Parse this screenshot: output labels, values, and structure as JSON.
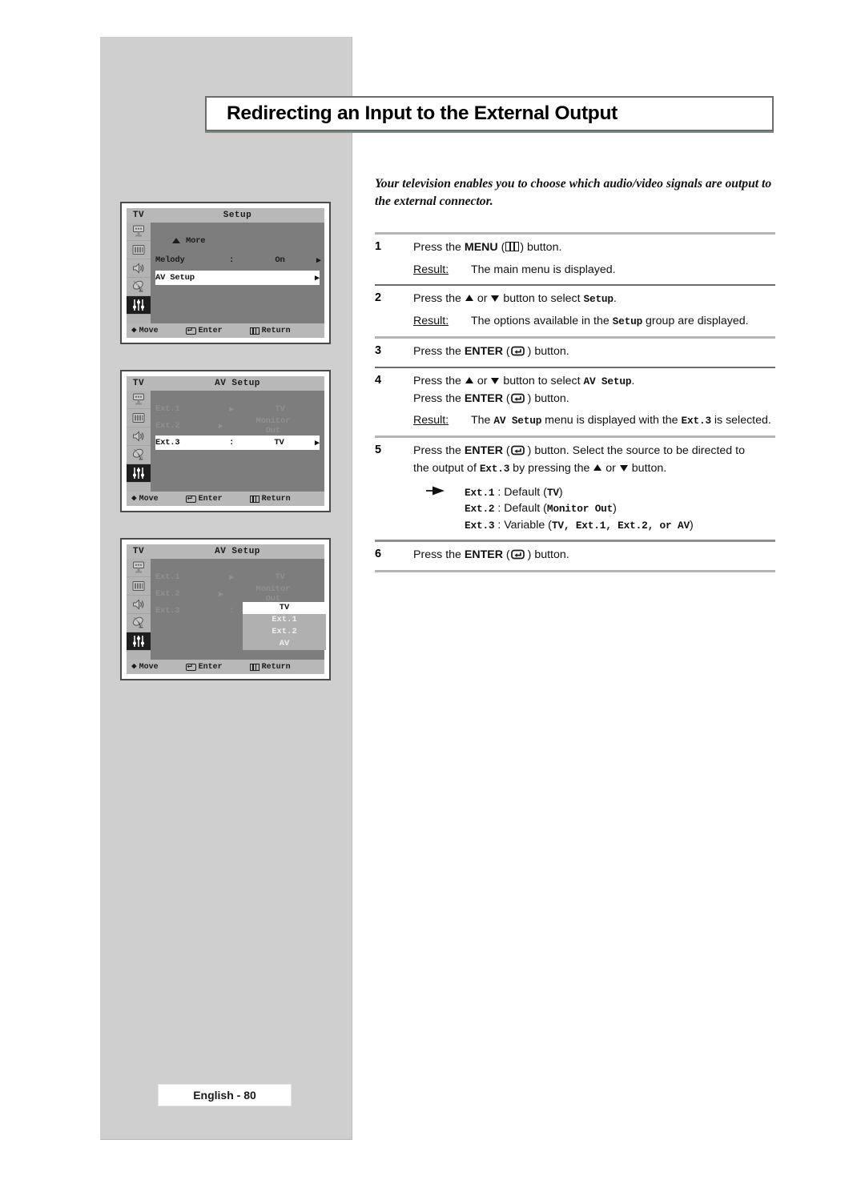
{
  "page": {
    "title": "Redirecting an Input to the External Output",
    "intro": "Your television enables you to choose which audio/video signals are output to the external connector.",
    "footer_label": "English - 80"
  },
  "steps": [
    {
      "num": "1",
      "lines": [
        "Press the MENU (▤) button."
      ],
      "press_prefix": "Press the ",
      "press_bold": "MENU",
      "press_suffix": " button.",
      "result_label": "Result:",
      "result_text": "The main menu is displayed."
    },
    {
      "num": "2",
      "press_prefix": "Press the ",
      "press_mid": " or ",
      "press_tail": " button to select ",
      "press_mono": "Setup",
      "press_end": ".",
      "result_label": "Result:",
      "result_pre": "The options available in the ",
      "result_mono": "Setup",
      "result_post": " group are displayed."
    },
    {
      "num": "3",
      "press_prefix": "Press the ",
      "press_bold": "ENTER",
      "press_suffix": " button."
    },
    {
      "num": "4",
      "press_prefix": "Press the ",
      "press_tail": " button to select ",
      "press_mono": "AV Setup",
      "press_end": ".",
      "press2_prefix": "Press the ",
      "press2_bold": "ENTER",
      "press2_suffix": " button.",
      "result_label": "Result:",
      "result_pre": "The ",
      "result_mono": "AV Setup",
      "result_mid": " menu is displayed with the ",
      "result_mono2": "Ext.3",
      "result_post": " is selected."
    },
    {
      "num": "5",
      "press_prefix": "Press the ",
      "press_bold": "ENTER",
      "press_suffix": " button. Select the source to be directed to",
      "press2_pre": "the output of ",
      "press2_mono": "Ext.3",
      "press2_mid": " by pressing the ",
      "press2_end": " button.",
      "notes": [
        {
          "name": "Ext.1",
          "sep": " : Default (",
          "value": "TV",
          "close": ")",
          "value_mono": true
        },
        {
          "name": "Ext.2",
          "sep": " : Default (",
          "value": "Monitor Out",
          "close": ")",
          "value_mono": true
        },
        {
          "name": "Ext.3",
          "sep": " : Variable (",
          "value": "TV, Ext.1, Ext.2, or AV",
          "close": ")",
          "value_mono": true
        }
      ]
    },
    {
      "num": "6",
      "press_prefix": "Press the ",
      "press_bold": "ENTER",
      "press_suffix": " button."
    }
  ],
  "osd": [
    {
      "id": "setup-menu",
      "tv_label": "TV",
      "title": "Setup",
      "rows": [
        {
          "kind": "more",
          "label": "More",
          "state": "dark"
        },
        {
          "kind": "item",
          "label": "Melody",
          "colon": ":",
          "value": "On",
          "arrow": "▶",
          "state": "dark"
        },
        {
          "kind": "item",
          "label": "AV Setup",
          "colon": "",
          "value": "",
          "arrow": "▶",
          "state": "selected"
        }
      ],
      "footer": {
        "move": "Move",
        "enter": "Enter",
        "return": "Return"
      }
    },
    {
      "id": "av-setup-menu",
      "tv_label": "TV",
      "title": "AV Setup",
      "rows": [
        {
          "kind": "item",
          "label": "Ext.1",
          "colon": "▶",
          "value": "TV",
          "arrow": "",
          "state": "dim"
        },
        {
          "kind": "item",
          "label": "Ext.2",
          "colon": "▶",
          "value": "Monitor Out",
          "arrow": "",
          "state": "dim"
        },
        {
          "kind": "item",
          "label": "Ext.3",
          "colon": ":",
          "value": "TV",
          "arrow": "▶",
          "state": "selected"
        }
      ],
      "footer": {
        "move": "Move",
        "enter": "Enter",
        "return": "Return"
      }
    },
    {
      "id": "av-setup-dropdown",
      "tv_label": "TV",
      "title": "AV Setup",
      "rows": [
        {
          "kind": "item",
          "label": "Ext.1",
          "colon": "▶",
          "value": "TV",
          "arrow": "",
          "state": "dim"
        },
        {
          "kind": "item",
          "label": "Ext.2",
          "colon": "▶",
          "value": "Monitor Out",
          "arrow": "",
          "state": "dim"
        },
        {
          "kind": "item",
          "label": "Ext.3",
          "colon": ":",
          "value": "",
          "arrow": "",
          "state": "dim"
        }
      ],
      "popup": {
        "options": [
          "TV",
          "Ext.1",
          "Ext.2",
          "AV"
        ],
        "selected": "TV"
      },
      "footer": {
        "move": "Move",
        "enter": "Enter",
        "return": "Return"
      }
    }
  ]
}
